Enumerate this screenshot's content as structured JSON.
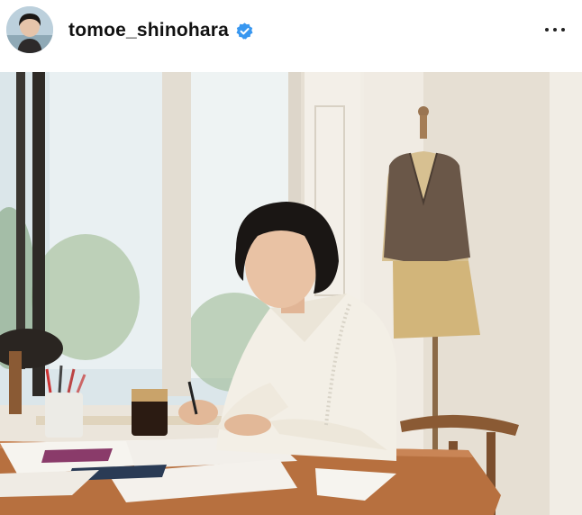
{
  "post": {
    "username": "tomoe_shinohara",
    "verified": true,
    "avatar_icon": "profile-photo",
    "more_icon": "more-options-icon",
    "photo_icon": "post-photo"
  },
  "colors": {
    "verified_badge": "#3897f0",
    "wall": "#ebe5db",
    "table_wood": "#b7703f",
    "blouse": "#f3efe6",
    "hair": "#1a1614"
  }
}
